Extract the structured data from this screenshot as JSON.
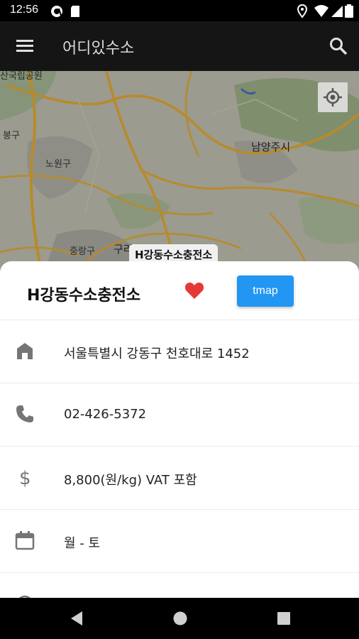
{
  "status_bar": {
    "time": "12:56",
    "icons": [
      "at-sign-icon",
      "sd-card-icon",
      "location-icon",
      "wifi-icon",
      "signal-icon",
      "battery-icon"
    ]
  },
  "app_bar": {
    "title": "어디있수소",
    "menu_icon": "menu-icon",
    "search_icon": "search-icon"
  },
  "map": {
    "labels": [
      "산국립공원",
      "봉구",
      "노원구",
      "남양주시",
      "중랑구",
      "구리"
    ],
    "marker_label": "H강동수소충전소",
    "locate_icon": "my-location-icon"
  },
  "station": {
    "name": "H강동수소충전소",
    "favorite_icon": "heart-icon",
    "favorite_color": "#e53935",
    "tmap_label": "tmap",
    "tmap_color": "#2196f3",
    "rows": [
      {
        "icon": "home-icon",
        "text": "서울특별시 강동구 천호대로 1452"
      },
      {
        "icon": "phone-icon",
        "text": "02-426-5372"
      },
      {
        "icon": "dollar-icon",
        "text": "8,800(원/kg) VAT 포함"
      },
      {
        "icon": "calendar-icon",
        "text": "월 - 토"
      }
    ]
  },
  "nav_bar": {
    "back_icon": "back-triangle-icon",
    "home_icon": "home-circle-icon",
    "recents_icon": "recents-square-icon"
  }
}
